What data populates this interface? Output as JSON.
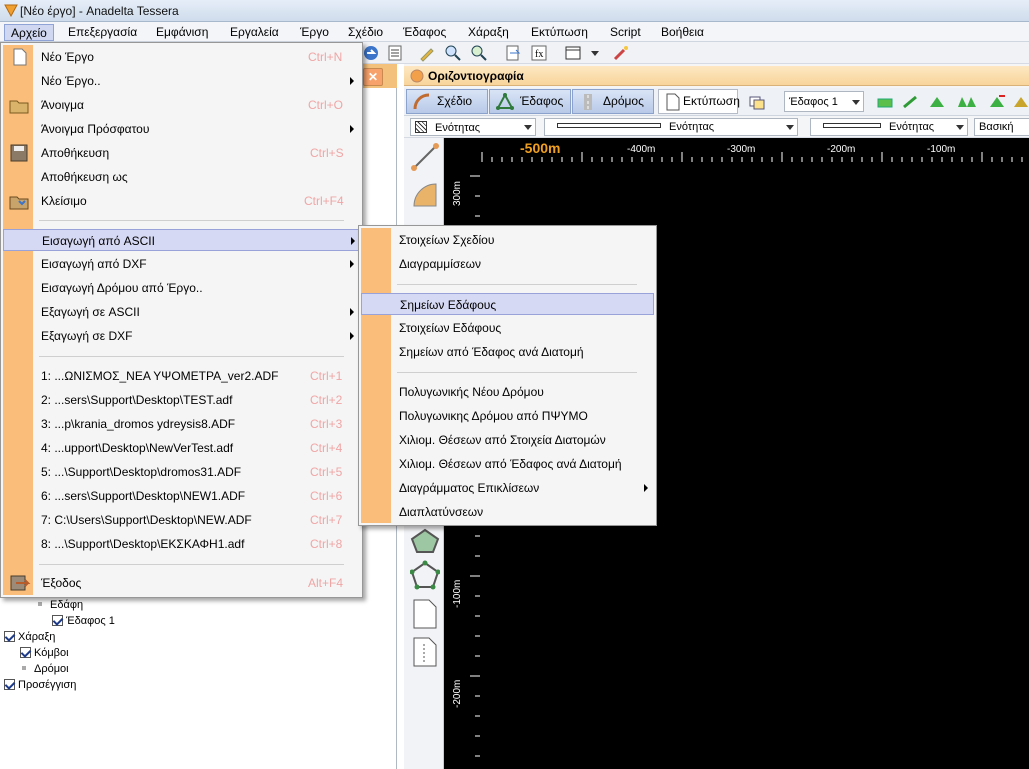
{
  "window": {
    "title": "[Νέο έργο] - Anadelta Tessera"
  },
  "menubar": {
    "items": [
      "Αρχείο",
      "Επεξεργασία",
      "Εμφάνιση",
      "Εργαλεία",
      "Έργο",
      "Σχέδιο",
      "Έδαφος",
      "Χάραξη",
      "Εκτύπωση",
      "Script",
      "Βοήθεια"
    ]
  },
  "file_menu": {
    "items": [
      {
        "label": "Νέο Έργο",
        "shortcut": "Ctrl+N",
        "icon": "new-document-icon"
      },
      {
        "label": "Νέο Έργο..",
        "shortcut": "",
        "submenu": true
      },
      {
        "label": "Άνοιγμα",
        "shortcut": "Ctrl+O",
        "icon": "open-folder-icon"
      },
      {
        "label": "Άνοιγμα Πρόσφατου",
        "shortcut": "",
        "submenu": true
      },
      {
        "label": "Αποθήκευση",
        "shortcut": "Ctrl+S",
        "icon": "save-disk-icon"
      },
      {
        "label": "Αποθήκευση ως",
        "shortcut": ""
      },
      {
        "label": "Κλείσιμο",
        "shortcut": "Ctrl+F4",
        "icon": "close-folder-icon"
      },
      {
        "label": "Εισαγωγή από ASCII",
        "shortcut": "",
        "submenu": true,
        "highlighted": true
      },
      {
        "label": "Εισαγωγή από DXF",
        "shortcut": "",
        "submenu": true
      },
      {
        "label": "Εισαγωγή Δρόμου από Έργο..",
        "shortcut": ""
      },
      {
        "label": "Εξαγωγή σε ASCII",
        "shortcut": "",
        "submenu": true
      },
      {
        "label": "Εξαγωγή σε DXF",
        "shortcut": "",
        "submenu": true
      },
      {
        "label": "1: ...ΩΝΙΣΜΟΣ_ΝΕΑ ΥΨΟΜΕΤΡΑ_ver2.ADF",
        "shortcut": "Ctrl+1"
      },
      {
        "label": "2: ...sers\\Support\\Desktop\\TEST.adf",
        "shortcut": "Ctrl+2"
      },
      {
        "label": "3: ...p\\krania_dromos ydreysis8.ADF",
        "shortcut": "Ctrl+3"
      },
      {
        "label": "4: ...upport\\Desktop\\NewVerTest.adf",
        "shortcut": "Ctrl+4"
      },
      {
        "label": "5: ...\\Support\\Desktop\\dromos31.ADF",
        "shortcut": "Ctrl+5"
      },
      {
        "label": "6: ...sers\\Support\\Desktop\\NEW1.ADF",
        "shortcut": "Ctrl+6"
      },
      {
        "label": "7: C:\\Users\\Support\\Desktop\\NEW.ADF",
        "shortcut": "Ctrl+7"
      },
      {
        "label": "8: ...\\Support\\Desktop\\ΕΚΣΚΑΦΗ1.adf",
        "shortcut": "Ctrl+8"
      },
      {
        "label": "Έξοδος",
        "shortcut": "Alt+F4",
        "icon": "exit-icon"
      }
    ]
  },
  "ascii_submenu": {
    "items": [
      {
        "label": "Στοιχείων Σχεδίου"
      },
      {
        "label": "Διαγραμμίσεων"
      },
      {
        "label": "Σημείων Εδάφους",
        "highlighted": true
      },
      {
        "label": "Στοιχείων Εδάφους"
      },
      {
        "label": "Σημείων από Έδαφος ανά Διατομή"
      },
      {
        "label": "Πολυγωνικής Νέου Δρόμου"
      },
      {
        "label": "Πολυγωνικης Δρόμου από ΠΨΥΜΟ"
      },
      {
        "label": "Χιλιομ. Θέσεων από Στοιχεία Διατομών"
      },
      {
        "label": "Χιλιομ. Θέσεων από Έδαφος ανά Διατομή"
      },
      {
        "label": "Διαγράμματος Επικλίσεων",
        "submenu": true
      },
      {
        "label": "Διαπλατύνσεων"
      }
    ]
  },
  "tree": {
    "items": [
      {
        "label": "Εδάφη",
        "checked": false
      },
      {
        "label": "Έδαφος 1",
        "checked": true
      },
      {
        "label": "Χάραξη",
        "checked": true
      },
      {
        "label": "Κόμβοι",
        "checked": true
      },
      {
        "label": "Δρόμοι",
        "checked": false
      },
      {
        "label": "Προσέγγιση",
        "checked": true
      }
    ]
  },
  "right_panel": {
    "title": "Οριζοντιογραφία",
    "tabs": [
      {
        "label": "Σχέδιο"
      },
      {
        "label": "Έδαφος"
      },
      {
        "label": "Δρόμος"
      }
    ],
    "print_label": "Εκτύπωση",
    "ground_select": "Έδαφος 1",
    "line_combos": [
      "Ενότητας",
      "Ενότητας",
      "Ενότητας"
    ],
    "basic_label": "Βασική",
    "ruler_top": [
      "-500m",
      "-400m",
      "-300m",
      "-200m",
      "-100m"
    ],
    "ruler_left": [
      "300m",
      "-100m",
      "-200m"
    ]
  }
}
